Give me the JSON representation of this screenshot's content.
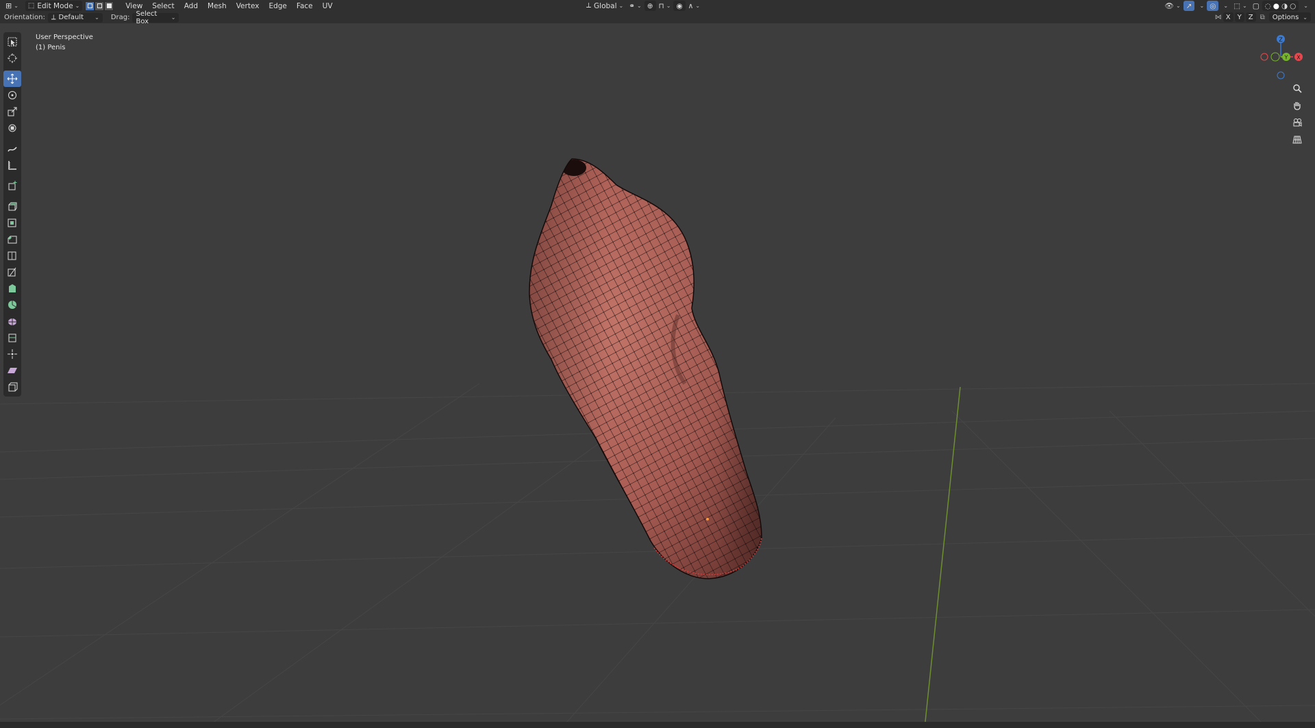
{
  "header": {
    "mode_label": "Edit Mode",
    "menus": [
      "View",
      "Select",
      "Add",
      "Mesh",
      "Vertex",
      "Edge",
      "Face",
      "UV"
    ],
    "transform_orientation": "Global",
    "axis_labels": [
      "X",
      "Y",
      "Z"
    ],
    "options_label": "Options"
  },
  "tool_settings": {
    "orientation_label": "Orientation:",
    "orientation_value": "Default",
    "drag_label": "Drag:",
    "drag_value": "Select Box"
  },
  "viewport": {
    "perspective_label": "User Perspective",
    "object_label": "(1) Penis",
    "mesh_color": "#b5675e",
    "background_color": "#3d3d3d"
  },
  "gizmo": {
    "z_label": "Z",
    "y_label": "Y",
    "x_label": "X",
    "x_color": "#e8484d",
    "y_color": "#77b52c",
    "z_color": "#3b7bd3"
  },
  "tools": [
    "select-box",
    "cursor",
    "move",
    "rotate",
    "scale",
    "transform",
    "annotate",
    "measure",
    "add-cube",
    "extrude",
    "inset",
    "bevel",
    "loop-cut",
    "knife",
    "poly-build",
    "spin",
    "smooth",
    "edge-slide",
    "shrink-fatten",
    "shear",
    "rip-region"
  ]
}
